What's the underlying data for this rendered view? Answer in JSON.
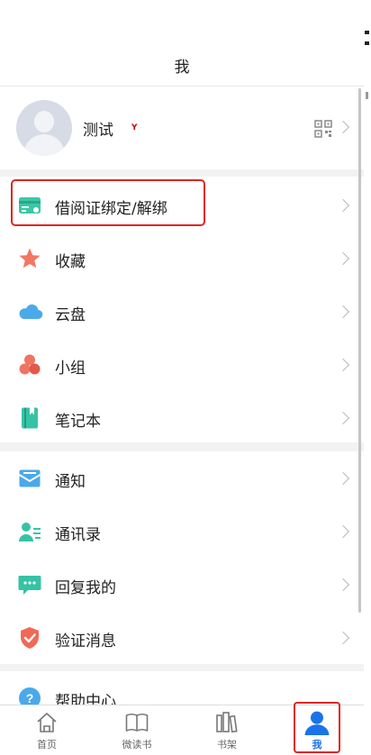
{
  "header": {
    "title": "我"
  },
  "profile": {
    "name": "测试",
    "mark": "Y"
  },
  "group1": [
    {
      "label": "借阅证绑定/解绑",
      "icon": "library-card-icon"
    },
    {
      "label": "收藏",
      "icon": "star-icon"
    },
    {
      "label": "云盘",
      "icon": "cloud-icon"
    },
    {
      "label": "小组",
      "icon": "group-icon"
    },
    {
      "label": "笔记本",
      "icon": "notebook-icon"
    }
  ],
  "group2": [
    {
      "label": "通知",
      "icon": "mail-icon"
    },
    {
      "label": "通讯录",
      "icon": "contacts-icon"
    },
    {
      "label": "回复我的",
      "icon": "reply-icon"
    },
    {
      "label": "验证消息",
      "icon": "shield-check-icon"
    }
  ],
  "group3": [
    {
      "label": "帮助中心",
      "icon": "help-icon"
    }
  ],
  "tabbar": [
    {
      "label": "首页",
      "icon": "home-icon"
    },
    {
      "label": "微读书",
      "icon": "book-icon"
    },
    {
      "label": "书架",
      "icon": "bookshelf-icon"
    },
    {
      "label": "我",
      "icon": "user-icon",
      "active": true
    }
  ],
  "colors": {
    "highlight": "#e0251e",
    "accent": "#1a73e8"
  }
}
